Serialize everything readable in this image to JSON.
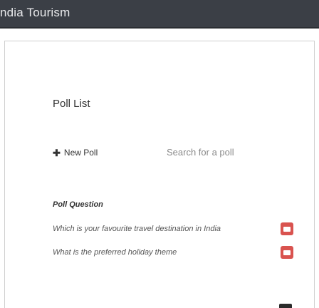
{
  "app": {
    "brand": "ndia Tourism"
  },
  "poll_list": {
    "title": "Poll List",
    "new_poll_label": "New Poll",
    "search_placeholder": "Search for a poll",
    "column_header": "Poll Question",
    "polls": [
      {
        "question": "Which is your favourite travel destination in India"
      },
      {
        "question": "What is the preferred holiday theme"
      }
    ]
  },
  "colors": {
    "navbar": "#3b3f46",
    "action_button": "#d9534f"
  },
  "icons": {
    "new_poll": "plus-icon",
    "row_action": "remove-icon"
  }
}
